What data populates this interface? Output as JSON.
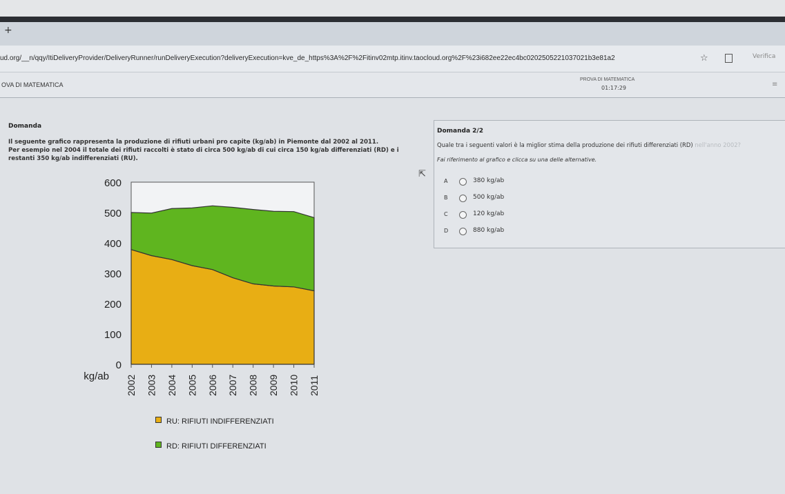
{
  "browser": {
    "new_tab": "+",
    "url": "ud.org/__n/qqy/ItiDeliveryProvider/DeliveryRunner/runDeliveryExecution?deliveryExecution=kve_de_https%3A%2F%2Fitinv02mtp.itinv.taocloud.org%2F%23i682ee22ec4bc0202505221037021b3e81a2",
    "profile_label": "Verifica"
  },
  "app": {
    "title": "OVA DI MATEMATICA",
    "exam_name": "PROVA DI MATEMATICA",
    "timer": "01:17:29"
  },
  "question": {
    "label": "Domanda",
    "text_line1": "Il seguente grafico rappresenta la produzione di rifiuti urbani pro capite (kg/ab) in Piemonte dal 2002 al 2011.",
    "text_line2": "Per esempio nel 2004 il totale dei rifiuti raccolti è stato di circa 500 kg/ab di cui circa 150 kg/ab differenziati (RD) e i",
    "text_line3": "restanti 350 kg/ab indifferenziati (RU)."
  },
  "chart_data": {
    "type": "area",
    "x": [
      "2002",
      "2003",
      "2004",
      "2005",
      "2006",
      "2007",
      "2008",
      "2009",
      "2010",
      "2011"
    ],
    "ylabel": "kg/ab",
    "ylim": [
      0,
      600
    ],
    "yticks": [
      0,
      100,
      200,
      300,
      400,
      500,
      600
    ],
    "stacked": true,
    "grid": false,
    "series": [
      {
        "name": "RU: RIFIUTI INDIFFERENZIATI",
        "color": "#e8ae14",
        "values": [
          378,
          358,
          345,
          325,
          312,
          285,
          265,
          258,
          255,
          242
        ]
      },
      {
        "name": "RD: RIFIUTI DIFFERENZIATI",
        "color": "#5fb51f",
        "values": [
          122,
          140,
          168,
          190,
          210,
          232,
          245,
          246,
          248,
          241
        ]
      }
    ],
    "legend_position": "bottom"
  },
  "panel": {
    "number": "Domanda 2/2",
    "question_main": "Quale tra i seguenti valori è la miglior stima della produzione dei rifiuti differenziati (RD)",
    "question_faded": " nell'anno 2002?",
    "instruction": "Fai riferimento al grafico e clicca su una delle alternative.",
    "options": [
      {
        "letter": "A",
        "value": "380 kg/ab"
      },
      {
        "letter": "B",
        "value": "500 kg/ab"
      },
      {
        "letter": "C",
        "value": "120 kg/ab"
      },
      {
        "letter": "D",
        "value": "880 kg/ab"
      }
    ]
  },
  "icons": {
    "star": "star-icon",
    "extension": "extension-icon",
    "menu": "menu-icon",
    "cursor": "mouse-cursor-icon"
  }
}
